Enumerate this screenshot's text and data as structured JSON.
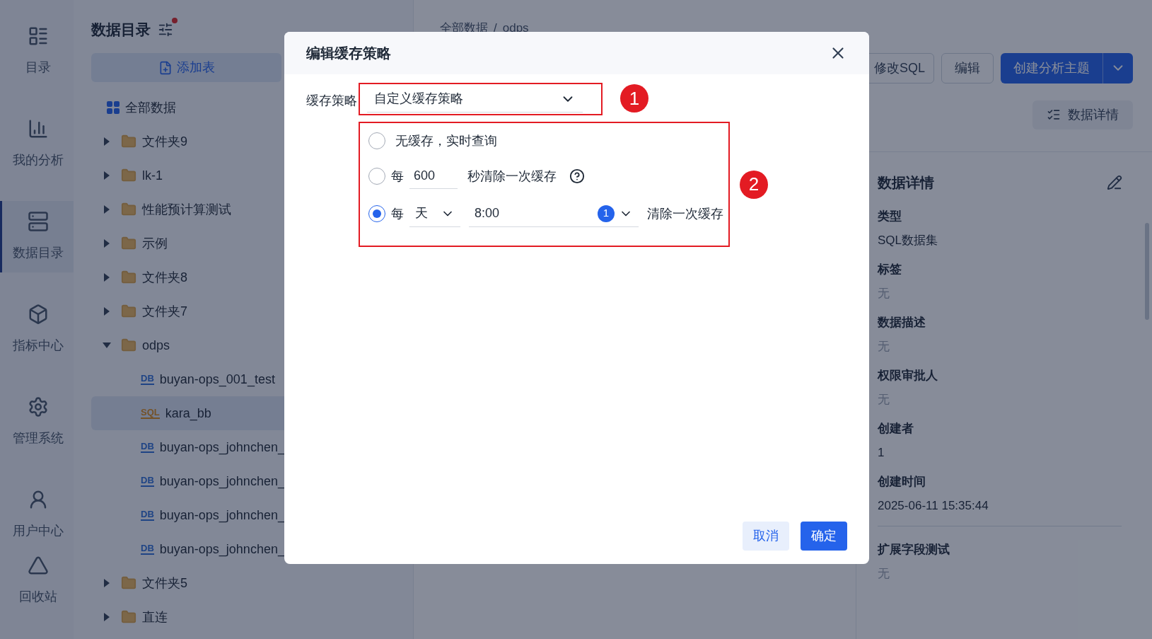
{
  "nav": [
    {
      "label": "目录",
      "selected": false
    },
    {
      "label": "我的分析",
      "selected": false
    },
    {
      "label": "数据目录",
      "selected": true
    },
    {
      "label": "指标中心",
      "selected": false
    },
    {
      "label": "管理系统",
      "selected": false
    },
    {
      "label": "用户中心",
      "selected": false
    },
    {
      "label": "回收站",
      "selected": false
    }
  ],
  "catalog": {
    "title": "数据目录",
    "notification_dot": true,
    "add_button": "添加表",
    "tree": [
      {
        "label": "全部数据",
        "kind": "all",
        "selected": false
      },
      {
        "label": "文件夹9",
        "kind": "folder",
        "expanded": false,
        "selected": false
      },
      {
        "label": "lk-1",
        "kind": "folder",
        "expanded": false,
        "selected": false
      },
      {
        "label": "性能预计算测试",
        "kind": "folder",
        "expanded": false,
        "selected": false
      },
      {
        "label": "示例",
        "kind": "folder",
        "expanded": false,
        "selected": false
      },
      {
        "label": "文件夹8",
        "kind": "folder",
        "expanded": false,
        "selected": false
      },
      {
        "label": "文件夹7",
        "kind": "folder",
        "expanded": false,
        "selected": false
      },
      {
        "label": "odps",
        "kind": "folder",
        "expanded": true,
        "selected": false,
        "children": [
          {
            "label": "buyan-ops_001_test",
            "kind": "db",
            "icon_text": "DB",
            "selected": false
          },
          {
            "label": "kara_bb",
            "kind": "sql",
            "icon_text": "SQL",
            "selected": true
          },
          {
            "label": "buyan-ops_johnchen_",
            "kind": "db",
            "icon_text": "DB",
            "selected": false
          },
          {
            "label": "buyan-ops_johnchen_",
            "kind": "db",
            "icon_text": "DB",
            "selected": false
          },
          {
            "label": "buyan-ops_johnchen_",
            "kind": "db",
            "icon_text": "DB",
            "selected": false
          },
          {
            "label": "buyan-ops_johnchen_",
            "kind": "db",
            "icon_text": "DB",
            "selected": false
          }
        ]
      },
      {
        "label": "文件夹5",
        "kind": "folder",
        "expanded": false,
        "selected": false
      },
      {
        "label": "直连",
        "kind": "folder",
        "expanded": false,
        "selected": false
      }
    ]
  },
  "breadcrumb": {
    "separator": "/",
    "items": [
      "全部数据",
      "odps"
    ]
  },
  "toolbar": [
    {
      "label": "修改SQL",
      "kind": "outline"
    },
    {
      "label": "编辑",
      "kind": "outline"
    },
    {
      "label": "创建分析主题",
      "kind": "primary"
    }
  ],
  "details_button": "数据详情",
  "details": {
    "title": "数据详情",
    "fields": [
      {
        "label": "类型",
        "value": "SQL数据集",
        "muted": false,
        "divider": false
      },
      {
        "label": "标签",
        "value": "无",
        "muted": true,
        "divider": false
      },
      {
        "label": "数据描述",
        "value": "无",
        "muted": true,
        "divider": false
      },
      {
        "label": "权限审批人",
        "value": "无",
        "muted": true,
        "divider": false
      },
      {
        "label": "创建者",
        "value": "1",
        "muted": false,
        "divider": false
      },
      {
        "label": "创建时间",
        "value": "2025-06-11 15:35:44",
        "muted": false,
        "divider": true
      },
      {
        "label": "扩展字段测试",
        "value": "无",
        "muted": true,
        "divider": false
      }
    ]
  },
  "dialog": {
    "title": "编辑缓存策略",
    "strategy_label": "缓存策略",
    "strategy_value": "自定义缓存策略",
    "options": [
      {
        "kind": "none",
        "selected": false,
        "label": "无缓存，实时查询"
      },
      {
        "kind": "interval",
        "selected": false,
        "prefix": "每",
        "value": "600",
        "suffix": "秒清除一次缓存"
      },
      {
        "kind": "daily",
        "selected": true,
        "prefix": "每",
        "unit": "天",
        "time": "8:00",
        "count": "1",
        "suffix": "清除一次缓存"
      }
    ],
    "annotations": [
      "1",
      "2"
    ],
    "cancel": "取消",
    "ok": "确定"
  }
}
